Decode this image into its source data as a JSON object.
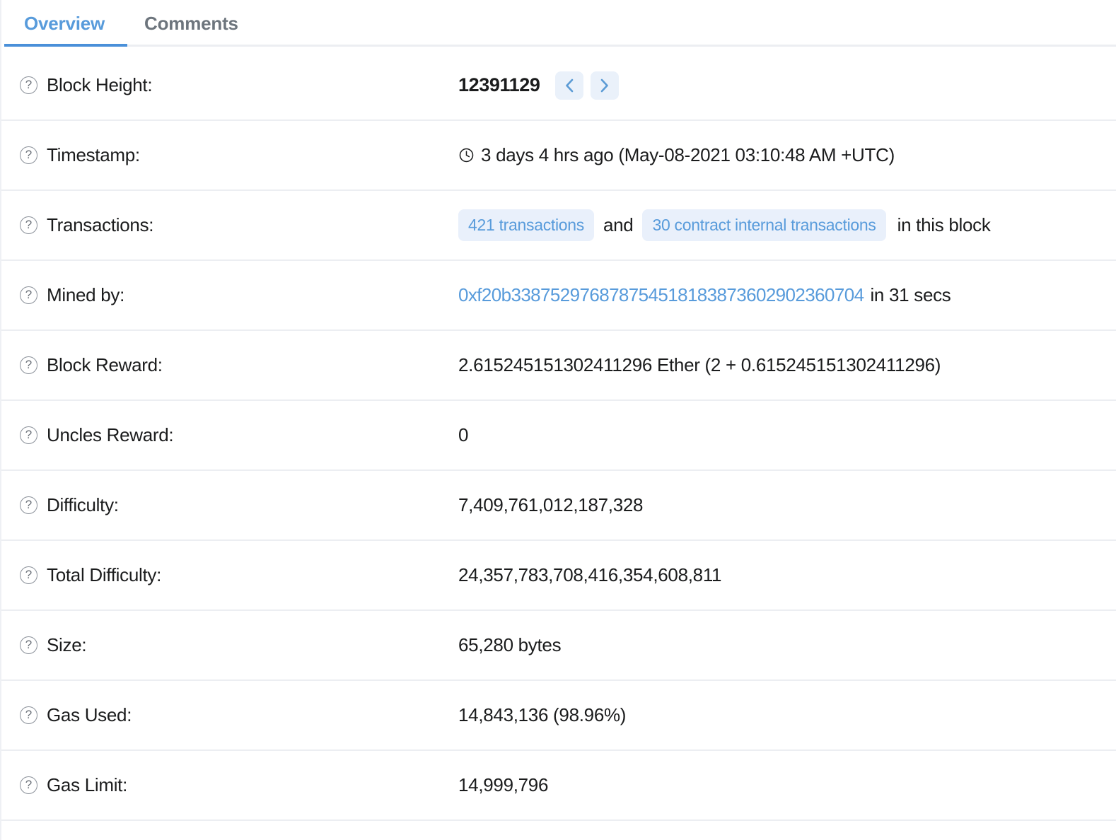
{
  "tabs": [
    {
      "label": "Overview",
      "active": true
    },
    {
      "label": "Comments",
      "active": false
    }
  ],
  "colors": {
    "accent_blue": "#4a90d9",
    "link_blue": "#589bdb",
    "badge_bg": "#e9f0fb",
    "nav_btn_bg": "#eaf1fa",
    "divider": "#eceef2",
    "inactive_tab": "#6d757d",
    "text": "#1b1c1d"
  },
  "rows": {
    "block_height": {
      "label": "Block Height:",
      "value": "12391129",
      "prev_title": "View previous block",
      "next_title": "View next block"
    },
    "timestamp": {
      "label": "Timestamp:",
      "value": "3 days 4 hrs ago (May-08-2021 03:10:48 AM +UTC)"
    },
    "transactions": {
      "label": "Transactions:",
      "txn_badge": "421 transactions",
      "conjunction": "and",
      "internal_badge": "30 contract internal transactions",
      "trailing": "in this block"
    },
    "mined_by": {
      "label": "Mined by:",
      "address": "0xf20b338752976878754518183873602902360704",
      "suffix": "in 31 secs"
    },
    "block_reward": {
      "label": "Block Reward:",
      "value": "2.615245151302411296 Ether (2 + 0.615245151302411296)"
    },
    "uncles_reward": {
      "label": "Uncles Reward:",
      "value": "0"
    },
    "difficulty": {
      "label": "Difficulty:",
      "value": "7,409,761,012,187,328"
    },
    "total_difficulty": {
      "label": "Total Difficulty:",
      "value": "24,357,783,708,416,354,608,811"
    },
    "size": {
      "label": "Size:",
      "value": "65,280 bytes"
    },
    "gas_used": {
      "label": "Gas Used:",
      "value": "14,843,136 (98.96%)"
    },
    "gas_limit": {
      "label": "Gas Limit:",
      "value": "14,999,796"
    }
  },
  "icons": {
    "help": "?"
  }
}
